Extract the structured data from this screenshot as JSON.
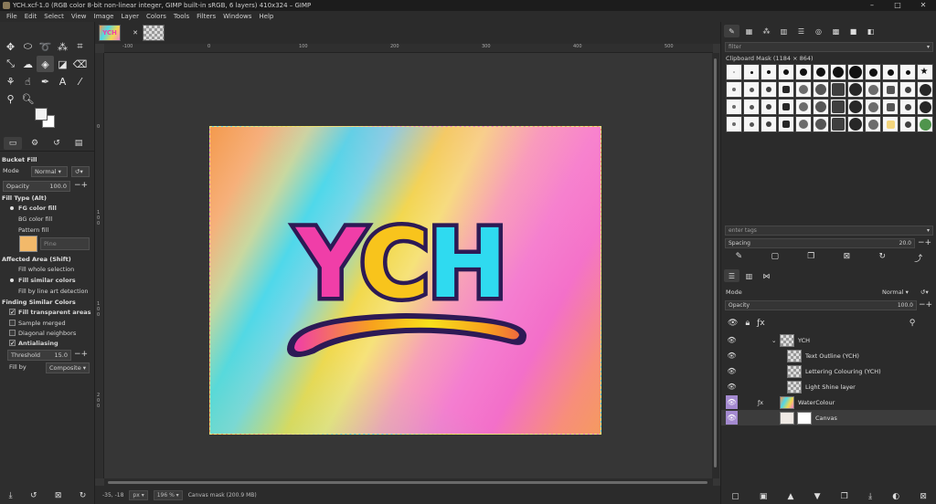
{
  "window": {
    "title": "YCH.xcf-1.0 (RGB color 8-bit non-linear integer, GIMP built-in sRGB, 6 layers) 410x324 – GIMP",
    "minimize": "–",
    "maximize": "□",
    "close": "✕"
  },
  "menu": [
    "File",
    "Edit",
    "Select",
    "View",
    "Image",
    "Layer",
    "Colors",
    "Tools",
    "Filters",
    "Windows",
    "Help"
  ],
  "image_tabs": {
    "thumb_text": "YCH",
    "close": "✕"
  },
  "tools": [
    "move-icon",
    "rect-select-icon",
    "lasso-icon",
    "fuzzy-select-icon",
    "crop-icon",
    "transform-icon",
    "warp-icon",
    "bucket-fill-icon",
    "gradient-icon",
    "eraser-icon",
    "clone-icon",
    "smudge-icon",
    "paths-icon",
    "text-icon",
    "color-picker-icon",
    "measure-icon",
    "zoom-icon"
  ],
  "tool_options": {
    "title": "Bucket Fill",
    "mode_label": "Mode",
    "mode_value": "Normal",
    "opacity_label": "Opacity",
    "opacity_value": "100.0",
    "fill_type": {
      "header": "Fill Type  (Alt)",
      "options": [
        "FG color fill",
        "BG color fill",
        "Pattern fill"
      ],
      "selected": 0,
      "pattern_name": "Pine"
    },
    "affected_area": {
      "header": "Affected Area  (Shift)",
      "options": [
        "Fill whole selection",
        "Fill similar colors",
        "Fill by line art detection"
      ],
      "selected": 1
    },
    "similar": {
      "header": "Finding Similar Colors",
      "checks": [
        {
          "label": "Fill transparent areas",
          "checked": true
        },
        {
          "label": "Sample merged",
          "checked": false
        },
        {
          "label": "Diagonal neighbors",
          "checked": false
        },
        {
          "label": "Antialiasing",
          "checked": true
        }
      ],
      "threshold_label": "Threshold",
      "threshold_value": "15.0",
      "fillby_label": "Fill by",
      "fillby_value": "Composite"
    }
  },
  "rulers": {
    "top": [
      "-100",
      "0",
      "100",
      "200",
      "300",
      "400",
      "500"
    ],
    "left": [
      "0",
      "1",
      "0",
      "0",
      "1",
      "0",
      "0",
      "2",
      "0",
      "0",
      "3",
      "0",
      "0",
      "4",
      "0"
    ]
  },
  "canvas": {
    "logo_text": [
      "Y",
      "C",
      "H"
    ]
  },
  "status": {
    "coords": "-35, -18",
    "unit": "px",
    "zoom": "196 %",
    "message": "Canvas mask (200.9 MB)"
  },
  "brushes": {
    "filter_placeholder": "filter",
    "header": "Clipboard Mask (1184 × 864)",
    "tags_placeholder": "enter tags",
    "spacing_label": "Spacing",
    "spacing_value": "20.0"
  },
  "layers": {
    "mode_label": "Mode",
    "mode_value": "Normal",
    "opacity_label": "Opacity",
    "opacity_value": "100.0",
    "items": [
      {
        "name": "YCH",
        "group": true,
        "indent": 0,
        "fx": false,
        "selected": false
      },
      {
        "name": "Text Outline (YCH)",
        "group": false,
        "indent": 1,
        "fx": false,
        "selected": false
      },
      {
        "name": "Lettering Colouring (YCH)",
        "group": false,
        "indent": 1,
        "fx": false,
        "selected": false
      },
      {
        "name": "Light Shine layer",
        "group": false,
        "indent": 1,
        "fx": false,
        "selected": false
      },
      {
        "name": "WaterColour",
        "group": false,
        "indent": 0,
        "fx": true,
        "selected": true
      },
      {
        "name": "Canvas",
        "group": false,
        "indent": 0,
        "fx": false,
        "selected": true
      }
    ]
  },
  "colors": {
    "accent": "#a48ad0",
    "logo_outline": "#2d1a55",
    "y": "#f03ea8",
    "c": "#f8c41c",
    "h": "#2fdaf0"
  }
}
